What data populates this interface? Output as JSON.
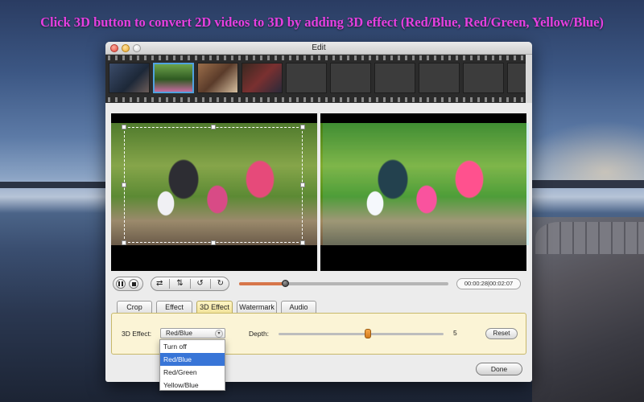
{
  "headline": "Click 3D button to convert 2D videos to 3D by adding 3D effect (Red/Blue, Red/Green, Yellow/Blue)",
  "window": {
    "title": "Edit"
  },
  "filmstrip": {
    "frames": [
      "thumb1",
      "thumb2",
      "thumb3",
      "thumb4",
      "empty",
      "empty",
      "empty",
      "empty",
      "empty",
      "empty"
    ],
    "selected_index": 1
  },
  "playback": {
    "time": "00:00:28|00:02:07",
    "progress": 0.22
  },
  "tabs": [
    "Crop",
    "Effect",
    "3D Effect",
    "Watermark",
    "Audio"
  ],
  "active_tab": "3D Effect",
  "effect3d": {
    "label": "3D Effect:",
    "selected": "Red/Blue",
    "options": [
      "Turn off",
      "Red/Blue",
      "Red/Green",
      "Yellow/Blue"
    ],
    "highlighted": "Red/Blue",
    "depth_label": "Depth:",
    "depth_value": "5",
    "depth_fraction": 0.54,
    "reset_label": "Reset"
  },
  "done_label": "Done",
  "colors": {
    "headline": "#e63fe0",
    "active_tab": "#f2e39a",
    "selection": "#3875d7",
    "progress": "#d7764a"
  }
}
